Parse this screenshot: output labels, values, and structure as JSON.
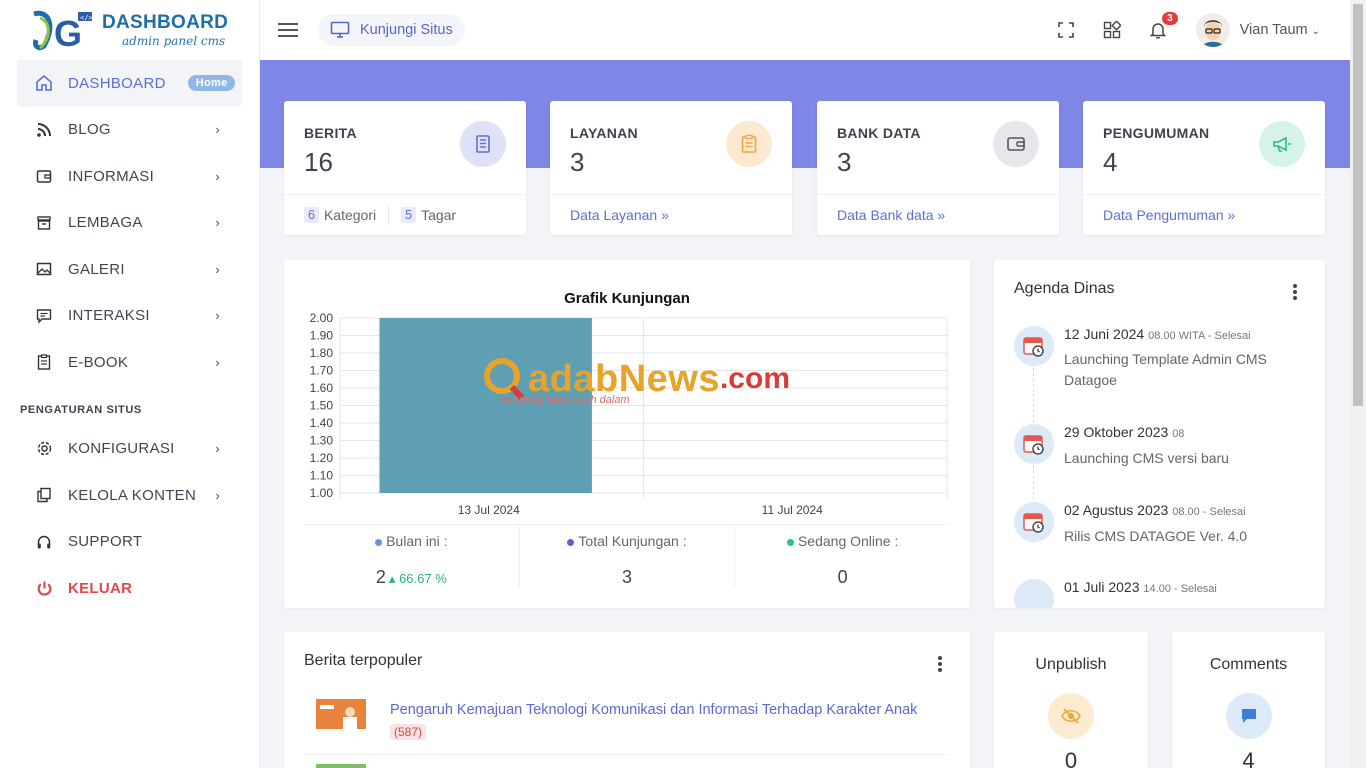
{
  "brand": {
    "title": "DASHBOARD",
    "subtitle": "admin panel cms"
  },
  "sidebar": {
    "items": [
      {
        "label": "DASHBOARD",
        "badge": "Home"
      },
      {
        "label": "BLOG"
      },
      {
        "label": "INFORMASI"
      },
      {
        "label": "LEMBAGA"
      },
      {
        "label": "GALERI"
      },
      {
        "label": "INTERAKSI"
      },
      {
        "label": "E-BOOK"
      }
    ],
    "section_title": "PENGATURAN SITUS",
    "settings": [
      {
        "label": "KONFIGURASI"
      },
      {
        "label": "KELOLA KONTEN"
      },
      {
        "label": "SUPPORT"
      },
      {
        "label": "KELUAR"
      }
    ]
  },
  "topbar": {
    "visit_label": "Kunjungi Situs",
    "notif_count": "3",
    "user_name": "Vian Taum"
  },
  "stats": [
    {
      "label": "BERITA",
      "value": "16",
      "kategori_count": "6",
      "kategori_label": "Kategori",
      "tagar_count": "5",
      "tagar_label": "Tagar",
      "color": "#dfe2f7"
    },
    {
      "label": "LAYANAN",
      "value": "3",
      "link": "Data Layanan »",
      "color": "#fde9cf"
    },
    {
      "label": "BANK DATA",
      "value": "3",
      "link": "Data Bank data »",
      "color": "#e6e7ea"
    },
    {
      "label": "PENGUMUMAN",
      "value": "4",
      "link": "Data Pengumuman »",
      "color": "#d6f3e7"
    }
  ],
  "chart_data": {
    "type": "bar",
    "title": "Grafik Kunjungan",
    "categories": [
      "13 Jul 2024",
      "11 Jul 2024"
    ],
    "values": [
      2,
      1
    ],
    "ylim": [
      1.0,
      2.0
    ],
    "yticks": [
      "2.00",
      "1.90",
      "1.80",
      "1.70",
      "1.60",
      "1.50",
      "1.40",
      "1.30",
      "1.20",
      "1.10",
      "1.00"
    ],
    "bar_color": "#5f9fb3",
    "grid": true
  },
  "visit_stats": [
    {
      "label": "Bulan ini :",
      "value": "2",
      "growth": "66.67 %",
      "dot": "#6b8fe0"
    },
    {
      "label": "Total Kunjungan :",
      "value": "3",
      "dot": "#5b5fd0"
    },
    {
      "label": "Sedang Online :",
      "value": "0",
      "dot": "#2cc08a"
    }
  ],
  "watermark": {
    "text": "adabNews",
    "suffix": ".com",
    "tagline": "teropong fakta lebih dalam"
  },
  "agenda": {
    "title": "Agenda Dinas",
    "items": [
      {
        "date": "12 Juni 2024",
        "meta": "08.00 WITA - Selesai",
        "title": "Launching Template Admin CMS Datagoe"
      },
      {
        "date": "29 Oktober 2023",
        "meta": "08",
        "title": "Launching CMS versi baru"
      },
      {
        "date": "02 Agustus 2023",
        "meta": "08.00 - Selesai",
        "title": "Rilis CMS DATAGOE Ver. 4.0"
      },
      {
        "date": "01 Juli 2023",
        "meta": "14.00 - Selesai",
        "title": ""
      }
    ]
  },
  "popular": {
    "title": "Berita terpopuler",
    "items": [
      {
        "title": "Pengaruh Kemajuan Teknologi Komunikasi dan Informasi Terhadap Karakter Anak",
        "views": "(587)"
      }
    ]
  },
  "unpublish": {
    "title": "Unpublish",
    "value": "0",
    "color": "#fcebd0"
  },
  "comments": {
    "title": "Comments",
    "value": "4",
    "color": "#dbe9f8"
  }
}
